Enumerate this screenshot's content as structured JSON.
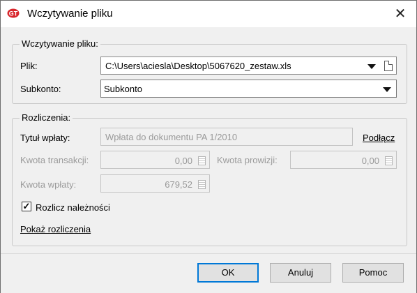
{
  "window": {
    "title": "Wczytywanie pliku",
    "close_glyph": "✕",
    "app_icon": "app-logo-icon"
  },
  "file_group": {
    "legend": "Wczytywanie pliku:",
    "file_label": "Plik:",
    "file_value": "C:\\Users\\aciesla\\Desktop\\5067620_zestaw.xls",
    "subaccount_label": "Subkonto:",
    "subaccount_value": "Subkonto"
  },
  "settlements_group": {
    "legend": "Rozliczenia:",
    "payment_title_label": "Tytuł wpłaty:",
    "payment_title_value": "Wpłata do dokumentu PA 1/2010",
    "attach_link": "Podłącz",
    "transaction_amount_label": "Kwota transakcji:",
    "transaction_amount_value": "0,00",
    "commission_amount_label": "Kwota prowizji:",
    "commission_amount_value": "0,00",
    "payment_amount_label": "Kwota wpłaty:",
    "payment_amount_value": "679,52",
    "settle_receivables_label": "Rozlicz należności",
    "settle_receivables_checked": true,
    "checkmark": "✓",
    "show_settlements_link": "Pokaż rozliczenia"
  },
  "buttons": {
    "ok": "OK",
    "cancel": "Anuluj",
    "help": "Pomoc"
  }
}
